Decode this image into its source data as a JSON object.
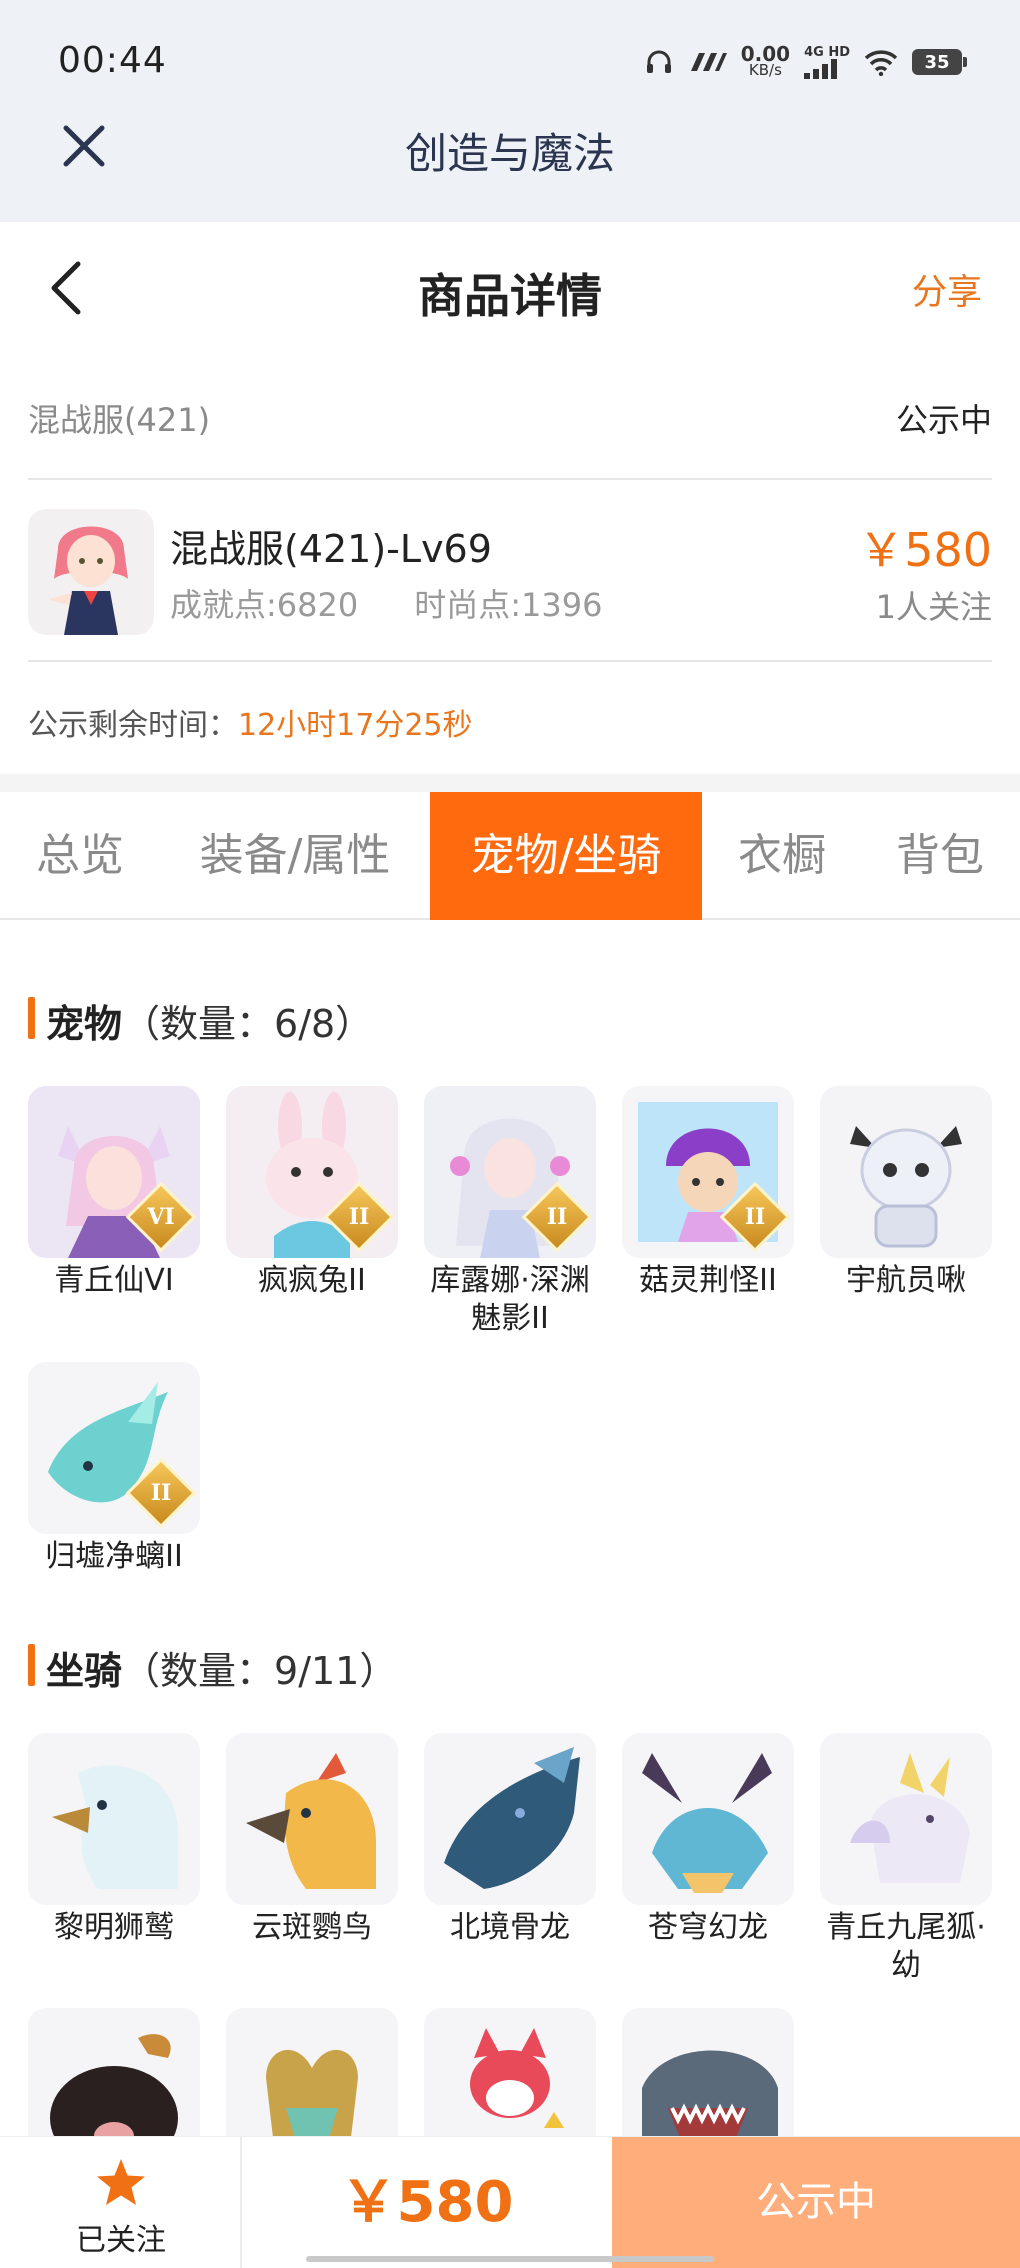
{
  "status_bar": {
    "time": "00:44",
    "net_speed_value": "0.00",
    "net_speed_unit": "KB/s",
    "signal_label": "4G HD",
    "battery": "35"
  },
  "app_header": {
    "title": "创造与魔法",
    "close_icon": "close-icon"
  },
  "nav": {
    "title": "商品详情",
    "share_label": "分享",
    "back_icon": "chevron-left-icon"
  },
  "server": {
    "name": "混战服(421)",
    "status": "公示中"
  },
  "item": {
    "title": "混战服(421)-Lv69",
    "achievement": "成就点:6820",
    "fashion": "时尚点:1396",
    "price": "￥580",
    "followers": "1人关注"
  },
  "remaining": {
    "label": "公示剩余时间：",
    "value": "12小时17分25秒"
  },
  "tabs": [
    {
      "label": "总览",
      "active": false
    },
    {
      "label": "装备/属性",
      "active": false
    },
    {
      "label": "宠物/坐骑",
      "active": true
    },
    {
      "label": "衣橱",
      "active": false
    },
    {
      "label": "背包",
      "active": false
    }
  ],
  "pets": {
    "heading": "宠物",
    "count": "（数量：6/8）",
    "items": [
      {
        "name": "青丘仙VI",
        "grade": "VI",
        "icon": "fox-girl-pet-icon"
      },
      {
        "name": "疯疯兔II",
        "grade": "II",
        "icon": "rabbit-pet-icon"
      },
      {
        "name": "库露娜·深渊魅影II",
        "grade": "II",
        "icon": "kuluna-pet-icon"
      },
      {
        "name": "菇灵荆怪II",
        "grade": "II",
        "icon": "mushroom-sprite-pet-icon"
      },
      {
        "name": "宇航员啾",
        "grade": "",
        "icon": "astronaut-pet-icon"
      },
      {
        "name": "归墟净螭II",
        "grade": "II",
        "icon": "water-dragon-pet-icon"
      }
    ]
  },
  "mounts": {
    "heading": "坐骑",
    "count": "（数量：9/11）",
    "items": [
      {
        "name": "黎明狮鹫",
        "icon": "griffin-mount-icon"
      },
      {
        "name": "云斑鹦鸟",
        "icon": "parrot-mount-icon"
      },
      {
        "name": "北境骨龙",
        "icon": "bone-dragon-mount-icon"
      },
      {
        "name": "苍穹幻龙",
        "icon": "sky-dragon-mount-icon"
      },
      {
        "name": "青丘九尾狐·幼",
        "icon": "nine-tail-fox-mount-icon"
      },
      {
        "name": "",
        "icon": "boar-mount-icon"
      },
      {
        "name": "",
        "icon": "gold-dragon-mount-icon"
      },
      {
        "name": "",
        "icon": "red-fox-mount-icon"
      },
      {
        "name": "",
        "icon": "shark-mount-icon"
      }
    ]
  },
  "bottom_bar": {
    "follow_label": "已关注",
    "price": "￥580",
    "status": "公示中",
    "colors": {
      "accent": "#f07014",
      "tab_active": "#ff6a0f",
      "status_bg": "#ffad7a"
    }
  }
}
